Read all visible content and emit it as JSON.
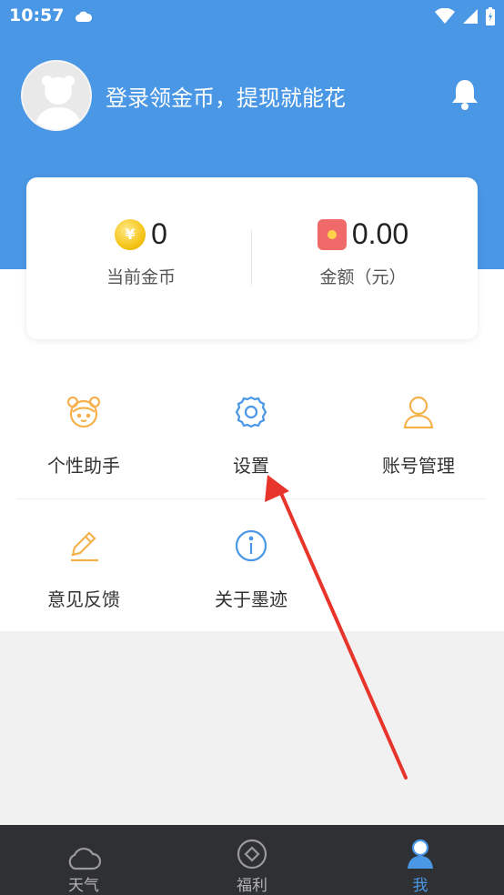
{
  "status_bar": {
    "time": "10:57"
  },
  "header": {
    "login_prompt": "登录领金币，提现就能花"
  },
  "stats": {
    "coins": {
      "value": "0",
      "label": "当前金币",
      "icon": "yen-coin-icon"
    },
    "amount": {
      "value": "0.00",
      "label": "金额（元）",
      "icon": "red-packet-icon"
    }
  },
  "menu": {
    "items": [
      {
        "label": "个性助手",
        "icon": "assistant-icon"
      },
      {
        "label": "设置",
        "icon": "gear-icon"
      },
      {
        "label": "账号管理",
        "icon": "user-icon"
      },
      {
        "label": "意见反馈",
        "icon": "pencil-icon"
      },
      {
        "label": "关于墨迹",
        "icon": "info-icon"
      }
    ]
  },
  "bottom_nav": {
    "items": [
      {
        "label": "天气",
        "icon": "cloud-icon"
      },
      {
        "label": "福利",
        "icon": "diamond-icon"
      },
      {
        "label": "我",
        "icon": "person-icon",
        "active": true
      }
    ]
  },
  "colors": {
    "brand_blue": "#4a97e6",
    "icon_orange": "#f5b24c",
    "arrow_red": "#e8352c"
  }
}
